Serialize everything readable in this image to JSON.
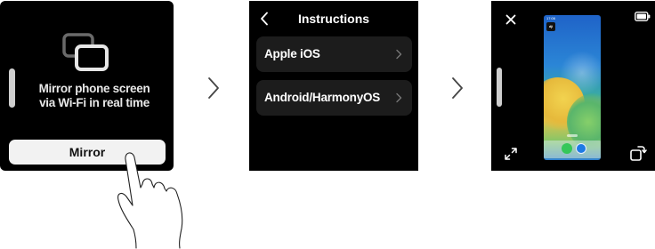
{
  "mirror_screen": {
    "description_line1": "Mirror phone screen",
    "description_line2": "via Wi-Fi in real time",
    "mirror_button_label": "Mirror"
  },
  "instructions_screen": {
    "title": "Instructions",
    "items": [
      {
        "label": "Apple iOS"
      },
      {
        "label": "Android/HarmonyOS"
      }
    ]
  },
  "mirroring_screen": {
    "phone_status_time": "17:06",
    "phone_app_label": "dji"
  },
  "colors": {
    "screen_bg": "#000000",
    "button_bg": "#f2f2f2",
    "list_item_bg": "#1c1c1c",
    "text_light": "#ffffff"
  },
  "icons": [
    "mirror-icon",
    "chevron-right-icon",
    "back-chevron-icon",
    "close-icon",
    "battery-icon",
    "expand-icon",
    "rotate-icon",
    "hand-pointer-icon"
  ]
}
